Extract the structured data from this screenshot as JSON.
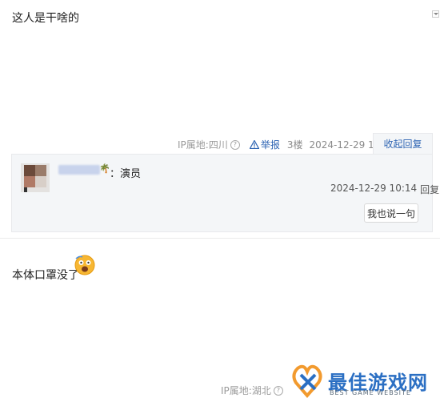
{
  "post1": {
    "text": "这人是干啥的",
    "ip_label": "IP属地:四川",
    "report_label": "举报",
    "floor": "3楼",
    "timestamp": "2024-12-29 10:10",
    "collapse_label": "收起回复"
  },
  "reply": {
    "user_suffix": "：演员",
    "timestamp": "2024-12-29 10:14",
    "reply_label": "回复",
    "say_button": "我也说一句"
  },
  "post2": {
    "text": "本体口罩没了",
    "ip_label": "IP属地:湖北"
  },
  "watermark": {
    "title": "最佳游戏网",
    "subtitle": "BEST GAME WEBSITE"
  },
  "colors": {
    "link": "#2d64b3",
    "reply_bg": "#f4f6f8",
    "brand_blue": "#2b6fc3",
    "brand_orange": "#f29a2e"
  },
  "icons": {
    "help": "help-circle-icon",
    "report": "warning-triangle-icon",
    "emoji": "scared-face-icon",
    "palm": "palm-tree-icon"
  }
}
